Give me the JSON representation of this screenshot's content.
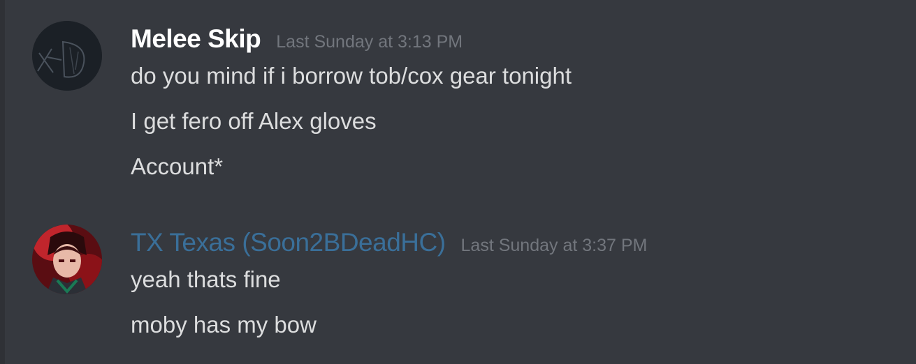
{
  "colors": {
    "background": "#36393f",
    "username_default": "#ffffff",
    "username_role": "#3a6f99",
    "timestamp": "#72767d",
    "message_text": "#dcddde"
  },
  "groups": [
    {
      "username": "Melee Skip",
      "timestamp": "Last Sunday at 3:13 PM",
      "avatar_icon": "sketch-avatar-icon",
      "messages": [
        "do you mind if i borrow tob/cox gear tonight",
        "I get fero off Alex gloves",
        "Account*"
      ]
    },
    {
      "username": "TX Texas (Soon2BDeadHC)",
      "timestamp": "Last Sunday at 3:37 PM",
      "avatar_icon": "anime-character-avatar-icon",
      "messages": [
        "yeah thats fine",
        "moby has my bow"
      ]
    }
  ]
}
